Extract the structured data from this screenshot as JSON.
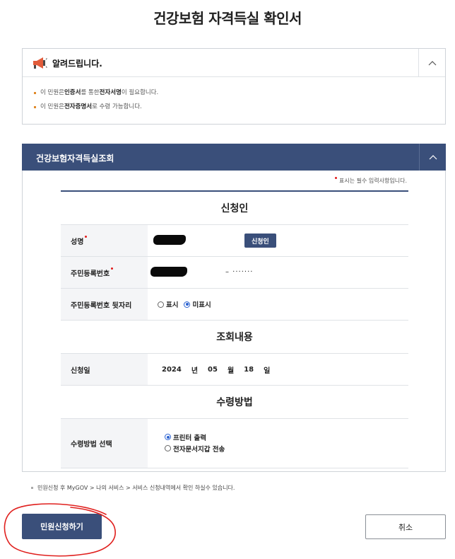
{
  "page": {
    "title": "건강보험 자격득실 확인서"
  },
  "notice": {
    "title": "알려드립니다.",
    "items": [
      {
        "pre": "이 민원은 ",
        "b1": "인증서",
        "mid": "를 통한 ",
        "b2": "전자서명",
        "post": "이 필요합니다."
      },
      {
        "pre": "이 민원은 ",
        "b1": "전자증명서",
        "mid": "로 수령 가능합니다.",
        "b2": "",
        "post": ""
      }
    ]
  },
  "section": {
    "title": "건강보험자격득실조회",
    "required_note": "표시는 필수 입력사항입니다.",
    "groups": {
      "applicant": "신청인",
      "inquiry": "조회내용",
      "receipt": "수령방법"
    },
    "fields": {
      "name_label": "성명",
      "applicant_button": "신청인",
      "rrn_label": "주민등록번호",
      "rrn_masked": "– ·······",
      "rrn_back_label": "주민등록번호 뒷자리",
      "rrn_back_options": [
        "표시",
        "미표시"
      ],
      "rrn_back_selected": "미표시",
      "date_label": "신청일",
      "date_year": "2024",
      "date_year_unit": "년",
      "date_month": "05",
      "date_month_unit": "월",
      "date_day": "18",
      "date_day_unit": "일",
      "receipt_label": "수령방법 선택",
      "receipt_options": [
        "프린터 출력",
        "전자문서지갑 전송"
      ],
      "receipt_selected": "프린터 출력"
    }
  },
  "footer_note": "민원신청 후 MyGOV > 나의 서비스 > 서비스 신청내역에서 확인 하실수 있습니다.",
  "buttons": {
    "submit": "민원신청하기",
    "cancel": "취소"
  },
  "colors": {
    "primary": "#3a4f7a",
    "required": "#e21b1b",
    "radio": "#2b62d1",
    "annotation": "#e0201e"
  }
}
